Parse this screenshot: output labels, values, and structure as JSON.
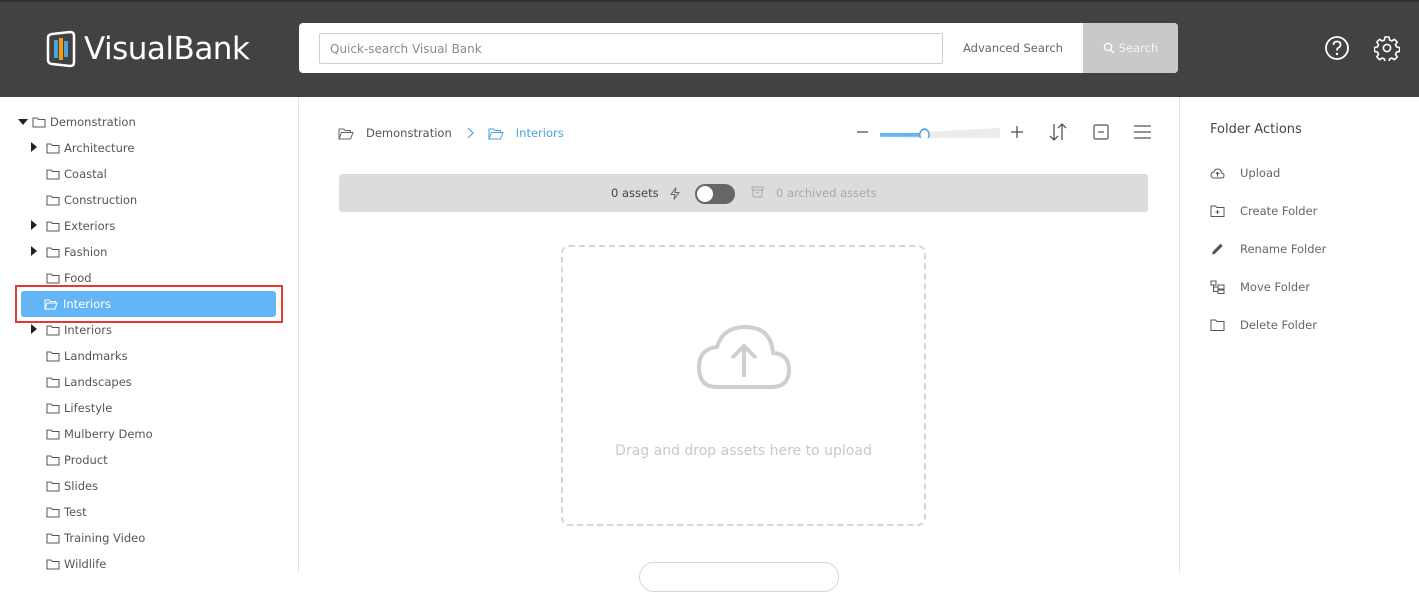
{
  "header": {
    "logo_text": "VisualBank",
    "search_placeholder": "Quick-search Visual Bank",
    "advanced_search": "Advanced Search",
    "search_button": "Search",
    "icons": [
      "help-icon",
      "settings-icon"
    ]
  },
  "sidebar": {
    "root": "Demonstration",
    "items": [
      {
        "label": "Architecture",
        "expandable": true
      },
      {
        "label": "Coastal",
        "expandable": false
      },
      {
        "label": "Construction",
        "expandable": false
      },
      {
        "label": "Exteriors",
        "expandable": true
      },
      {
        "label": "Fashion",
        "expandable": true
      },
      {
        "label": "Food",
        "expandable": false
      },
      {
        "label": "Interiors",
        "expandable": false,
        "selected": true
      },
      {
        "label": "Interiors",
        "expandable": true
      },
      {
        "label": "Landmarks",
        "expandable": false
      },
      {
        "label": "Landscapes",
        "expandable": false
      },
      {
        "label": "Lifestyle",
        "expandable": false
      },
      {
        "label": "Mulberry Demo",
        "expandable": false
      },
      {
        "label": "Product",
        "expandable": false
      },
      {
        "label": "Slides",
        "expandable": false
      },
      {
        "label": "Test",
        "expandable": false
      },
      {
        "label": "Training Video",
        "expandable": false
      },
      {
        "label": "Wildlife",
        "expandable": false
      }
    ]
  },
  "main": {
    "breadcrumb": [
      "Demonstration",
      "Interiors"
    ],
    "zoom_level": 0.37,
    "assets_count": "0 assets",
    "archived_count": "0 archived assets",
    "drop_text": "Drag and drop assets here to upload"
  },
  "right_panel": {
    "title": "Folder Actions",
    "actions": [
      "Upload",
      "Create Folder",
      "Rename Folder",
      "Move Folder",
      "Delete Folder"
    ]
  },
  "colors": {
    "header_bg": "#424242",
    "selected": "#64b5f6",
    "accent": "#4aa3df",
    "highlight_border": "#e53935"
  }
}
